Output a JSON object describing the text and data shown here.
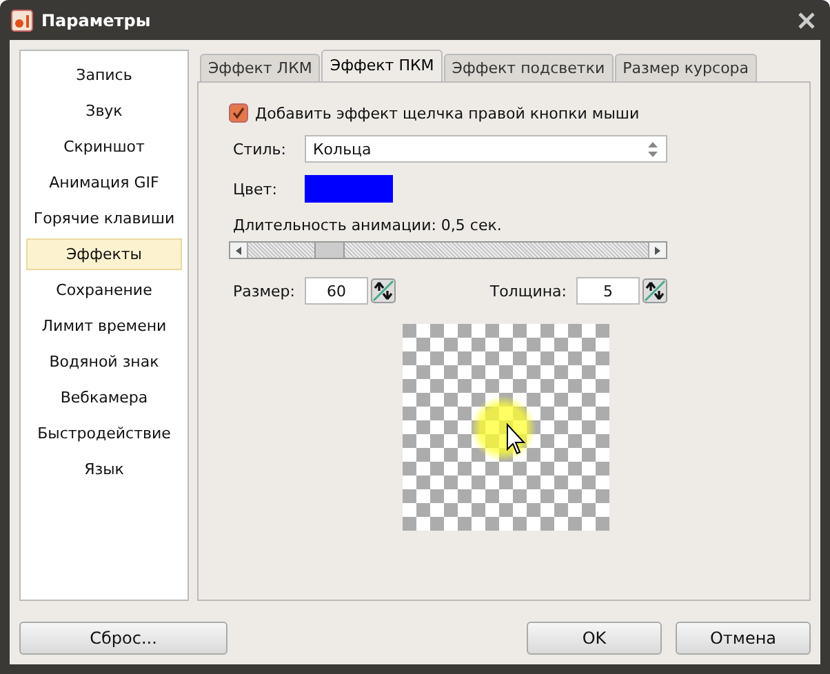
{
  "window": {
    "title": "Параметры"
  },
  "sidebar": {
    "items": [
      {
        "label": "Запись",
        "selected": false
      },
      {
        "label": "Звук",
        "selected": false
      },
      {
        "label": "Скриншот",
        "selected": false
      },
      {
        "label": "Анимация GIF",
        "selected": false
      },
      {
        "label": "Горячие клавиши",
        "selected": false
      },
      {
        "label": "Эффекты",
        "selected": true
      },
      {
        "label": "Сохранение",
        "selected": false
      },
      {
        "label": "Лимит времени",
        "selected": false
      },
      {
        "label": "Водяной знак",
        "selected": false
      },
      {
        "label": "Вебкамера",
        "selected": false
      },
      {
        "label": "Быстродействие",
        "selected": false
      },
      {
        "label": "Язык",
        "selected": false
      }
    ]
  },
  "tabs": [
    {
      "label": "Эффект ЛКМ",
      "selected": false
    },
    {
      "label": "Эффект ПКМ",
      "selected": true
    },
    {
      "label": "Эффект подсветки",
      "selected": false
    },
    {
      "label": "Размер курсора",
      "selected": false
    }
  ],
  "enable": {
    "label": "Добавить эффект щелчка правой кнопки мыши",
    "checked": true
  },
  "style": {
    "label": "Стиль:",
    "value": "Кольца"
  },
  "color": {
    "label": "Цвет:",
    "color": "#0000ff"
  },
  "duration": {
    "label": "Длительность анимации: 0,5 сек.",
    "level": 0.18
  },
  "size": {
    "label": "Размер:",
    "value": "60"
  },
  "thickness": {
    "label": "Толщина:",
    "value": "5"
  },
  "buttons": {
    "reset": "Сброс...",
    "ok": "OK",
    "cancel": "Отмена"
  }
}
